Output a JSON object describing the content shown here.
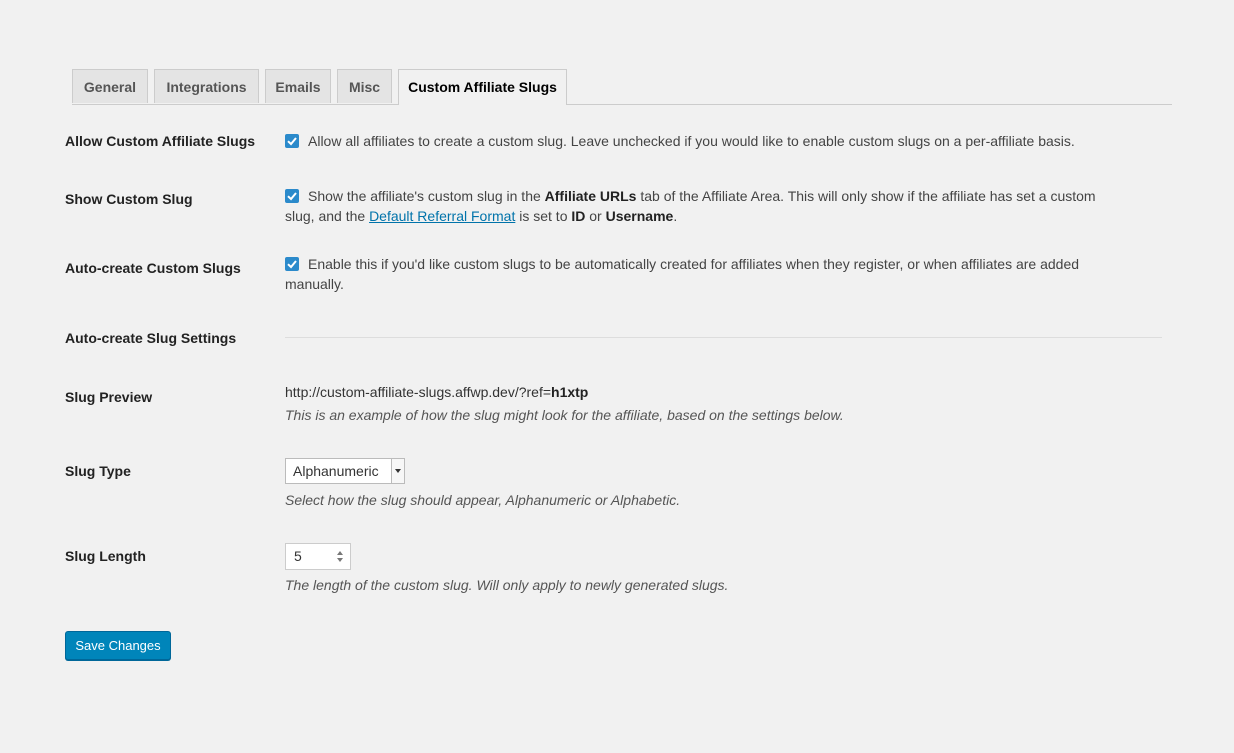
{
  "tabs": [
    {
      "label": "General"
    },
    {
      "label": "Integrations"
    },
    {
      "label": "Emails"
    },
    {
      "label": "Misc"
    },
    {
      "label": "Custom Affiliate Slugs"
    }
  ],
  "settings": {
    "allow": {
      "label": "Allow Custom Affiliate Slugs",
      "checked": true,
      "text": "Allow all affiliates to create a custom slug. Leave unchecked if you would like to enable custom slugs on a per-affiliate basis."
    },
    "show": {
      "label": "Show Custom Slug",
      "checked": true,
      "text_1": "Show the affiliate's custom slug in the ",
      "bold_1": "Affiliate URLs",
      "text_2": " tab of the Affiliate Area. This will only show if the affiliate has set a custom",
      "text_3": "slug, and the ",
      "link": "Default Referral Format",
      "text_4": " is set to ",
      "bold_2": "ID",
      "text_5": " or ",
      "bold_3": "Username",
      "text_6": "."
    },
    "autocreate": {
      "label": "Auto-create Custom Slugs",
      "checked": true,
      "text_1": "Enable this if you'd like custom slugs to be automatically created for affiliates when they register, or when affiliates are added",
      "text_2": "manually."
    },
    "section_heading": "Auto-create Slug Settings",
    "preview": {
      "label": "Slug Preview",
      "url_prefix": "http://custom-affiliate-slugs.affwp.dev/?ref=",
      "url_slug": "h1xtp",
      "desc": "This is an example of how the slug might look for the affiliate, based on the settings below."
    },
    "type": {
      "label": "Slug Type",
      "selected": "Alphanumeric",
      "desc": "Select how the slug should appear, Alphanumeric or Alphabetic."
    },
    "length": {
      "label": "Slug Length",
      "value": "5",
      "desc": "The length of the custom slug. Will only apply to newly generated slugs."
    }
  },
  "save_label": "Save Changes",
  "colors": {
    "accent": "#0085ba",
    "checkbox": "#2b8acb",
    "link": "#0073aa"
  }
}
